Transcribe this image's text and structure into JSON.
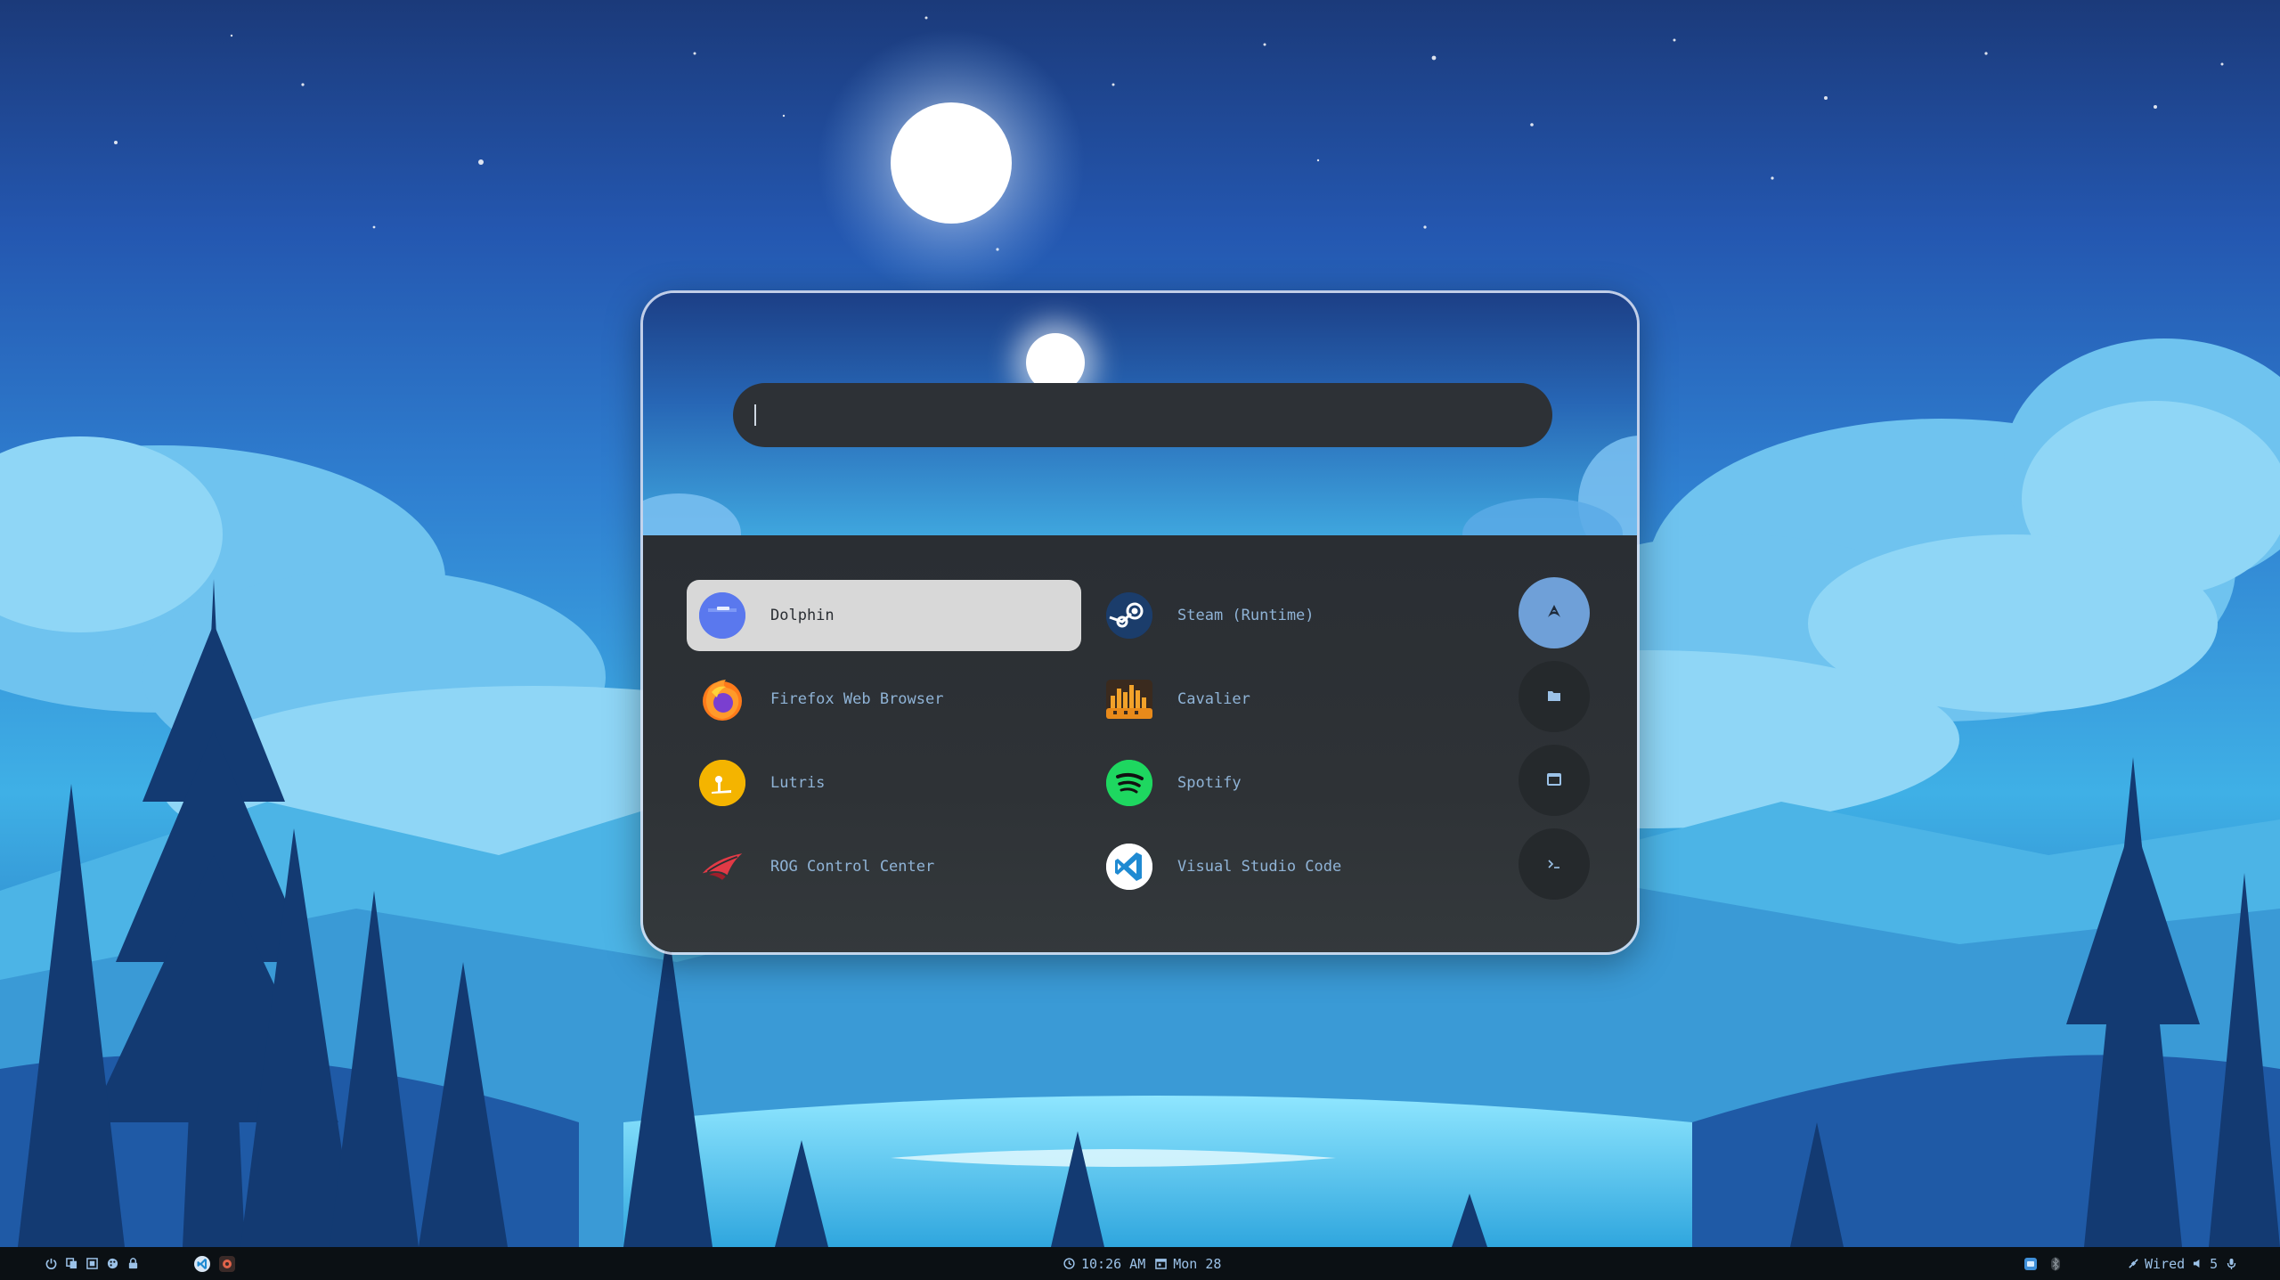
{
  "launcher": {
    "search": {
      "value": "",
      "placeholder": ""
    },
    "apps": [
      {
        "label": "Dolphin",
        "icon": "dolphin-icon",
        "selected": true
      },
      {
        "label": "Steam (Runtime)",
        "icon": "steam-icon",
        "selected": false
      },
      {
        "label": "Firefox Web Browser",
        "icon": "firefox-icon",
        "selected": false
      },
      {
        "label": "Cavalier",
        "icon": "cavalier-icon",
        "selected": false
      },
      {
        "label": "Lutris",
        "icon": "lutris-icon",
        "selected": false
      },
      {
        "label": "Spotify",
        "icon": "spotify-icon",
        "selected": false
      },
      {
        "label": "ROG Control Center",
        "icon": "rog-icon",
        "selected": false
      },
      {
        "label": "Visual Studio Code",
        "icon": "vscode-icon",
        "selected": false
      }
    ],
    "side_buttons": [
      {
        "icon": "arch-logo-icon",
        "active": true
      },
      {
        "icon": "folder-icon",
        "active": false
      },
      {
        "icon": "window-icon",
        "active": false
      },
      {
        "icon": "terminal-icon",
        "active": false
      }
    ]
  },
  "taskbar": {
    "clock": "10:26 AM",
    "date": "Mon 28",
    "network": "Wired",
    "volume": "5",
    "left_icons": [
      "power-icon",
      "copy-icon",
      "screenshot-icon",
      "palette-icon",
      "lock-icon"
    ],
    "app_icons": [
      "vscode-icon",
      "app-icon"
    ],
    "tray_icons": [
      "chat-icon",
      "bluetooth-icon"
    ]
  },
  "colors": {
    "accent": "#6fa0d8",
    "panel": "#2e3236",
    "selected": "#d8d8d8",
    "label": "#8fb3d6",
    "taskbar": "#0b1014"
  }
}
